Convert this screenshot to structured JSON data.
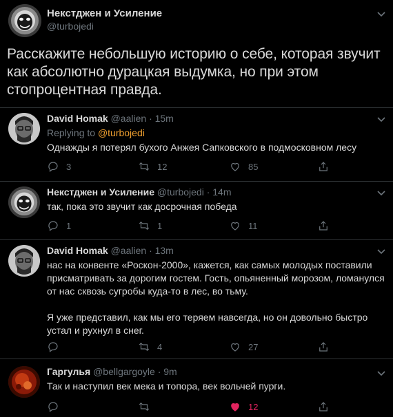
{
  "main_tweet": {
    "name": "Некстджен и Усиление",
    "handle": "@turbojedi",
    "text": "Расскажите небольшую историю о себе, которая звучит как абсолютно дурацкая выдумка, но при этом стопроцентная правда.",
    "avatar_icon": "astronaut-face-avatar"
  },
  "replies": [
    {
      "name": "David Homak",
      "handle": "@aalien",
      "time": "· 15m",
      "replying_prefix": "Replying to ",
      "replying_to": "@turbojedi",
      "body": [
        "Однажды я потерял бухого Анжея Сапковского в подмосковном лесу"
      ],
      "reply_count": "3",
      "retweet_count": "12",
      "like_count": "85",
      "liked": false,
      "avatar_icon": "man-with-glasses-avatar"
    },
    {
      "name": "Некстджен и Усиление",
      "handle": "@turbojedi",
      "time": "· 14m",
      "body": [
        "так, пока это звучит как досрочная победа"
      ],
      "reply_count": "1",
      "retweet_count": "1",
      "like_count": "11",
      "liked": false,
      "avatar_icon": "astronaut-face-avatar"
    },
    {
      "name": "David Homak",
      "handle": "@aalien",
      "time": "· 13m",
      "body": [
        "нас на конвенте «Роскон-2000», кажется, как самых молодых поставили присматривать за дорогим гостем. Гость, опьяненный морозом, ломанулся от нас сквозь сугробы куда-то в лес, во тьму.",
        "Я уже представил, как мы его теряем навсегда, но он довольно быстро устал и рухнул в снег."
      ],
      "reply_count": "",
      "retweet_count": "4",
      "like_count": "27",
      "liked": false,
      "avatar_icon": "man-with-glasses-avatar"
    },
    {
      "name": "Гаргулья",
      "handle": "@bellgargoyle",
      "time": "· 9m",
      "body": [
        "Так и наступил век мека и топора, век вольчей пурги."
      ],
      "reply_count": "",
      "retweet_count": "",
      "like_count": "12",
      "liked": true,
      "avatar_icon": "red-gargoyle-avatar"
    }
  ],
  "colors": {
    "background": "#000000",
    "text": "#d9d9d9",
    "muted": "#6e767d",
    "mention": "#f0a030",
    "like_active": "#e0245e",
    "divider": "#2f3336"
  }
}
